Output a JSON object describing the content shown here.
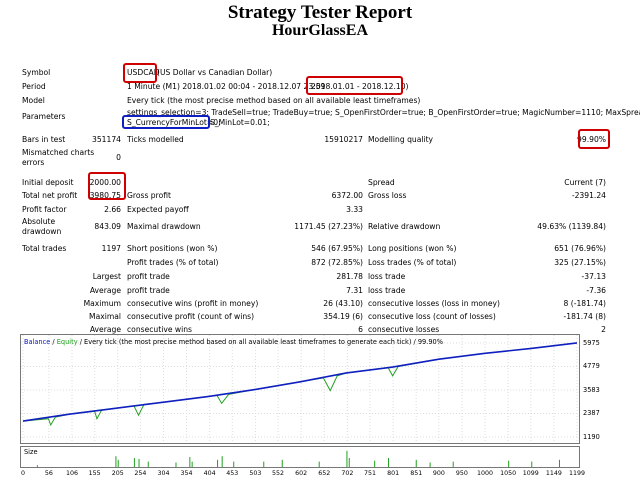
{
  "header": {
    "title": "Strategy Tester Report",
    "subtitle": "HourGlassEA"
  },
  "info": {
    "symbol_label": "Symbol",
    "symbol_code": "USDCAD",
    "symbol_desc": "(US Dollar vs Canadian Dollar)",
    "period_label": "Period",
    "period_prefix": "1 Minute (M1) 2018.01.02 00:04 - 2018.12.07 23:59",
    "period_range": "2018.01.01 - 2018.12.10)",
    "model_label": "Model",
    "model_value": "Every tick (the most precise method based on all available least timeframes)",
    "parameters_label": "Parameters",
    "param_line1": "settings_selection=3; TradeSell=true; TradeBuy=true; S_OpenFirstOrder=true; B_OpenFirstOrder=true; MagicNumber=1110; MaxSpread=5;",
    "param_highlight": "S_CurrencyForMinLot=0;",
    "param_rest": "S_MinLot=0.01;",
    "bars_label": "Bars in test",
    "bars_value": "351174",
    "ticks_label": "Ticks modelled",
    "ticks_value": "15910217",
    "quality_label": "Modelling quality",
    "quality_value": "99.90%",
    "mismatch_label_1": "Mismatched charts",
    "mismatch_label_2": "errors",
    "mismatch_value": "0"
  },
  "stats": {
    "initial_deposit_label": "Initial deposit",
    "initial_deposit_value": "2000.00",
    "spread_label": "Spread",
    "spread_value": "Current (7)",
    "net_profit_label": "Total net profit",
    "net_profit_value": "3980.75",
    "gross_profit_label": "Gross profit",
    "gross_profit_value": "6372.00",
    "gross_loss_label": "Gross loss",
    "gross_loss_value": "-2391.24",
    "profit_factor_label": "Profit factor",
    "profit_factor_value": "2.66",
    "expected_payoff_label": "Expected payoff",
    "expected_payoff_value": "3.33",
    "abs_dd_label_1": "Absolute",
    "abs_dd_label_2": "drawdown",
    "abs_dd_value": "843.09",
    "max_dd_label": "Maximal drawdown",
    "max_dd_value": "1171.45 (27.23%)",
    "rel_dd_label": "Relative drawdown",
    "rel_dd_value": "49.63% (1139.84)"
  },
  "trades": {
    "total_label": "Total trades",
    "total_value": "1197",
    "short_label": "Short positions (won %)",
    "short_value": "546 (67.95%)",
    "long_label": "Long positions (won %)",
    "long_value": "651 (76.96%)",
    "profit_trades_label": "Profit trades (% of total)",
    "profit_trades_value": "872 (72.85%)",
    "loss_trades_label": "Loss trades (% of total)",
    "loss_trades_value": "325 (27.15%)",
    "largest_label": "Largest",
    "largest_profit_label": "profit trade",
    "largest_profit_value": "281.78",
    "largest_loss_label": "loss trade",
    "largest_loss_value": "-37.13",
    "average_label": "Average",
    "average_profit_label": "profit trade",
    "average_profit_value": "7.31",
    "average_loss_label": "loss trade",
    "average_loss_value": "-7.36",
    "maximum_label": "Maximum",
    "max_wins_label": "consecutive wins (profit in money)",
    "max_wins_value": "26 (43.10)",
    "max_losses_label": "consecutive losses (loss in money)",
    "max_losses_value": "8 (-181.74)",
    "maximal_label": "Maximal",
    "maximal_profit_label": "consecutive profit (count of wins)",
    "maximal_profit_value": "354.19 (6)",
    "maximal_loss_label": "consecutive loss (count of losses)",
    "maximal_loss_value": "-181.74 (8)",
    "average2_label": "Average",
    "avg_wins_label": "consecutive wins",
    "avg_wins_value": "6",
    "avg_losses_label": "consecutive losses",
    "avg_losses_value": "2"
  },
  "chart_legend": {
    "balance": "Balance",
    "equity": "Equity",
    "rest": "/ Every tick (the most precise method based on all available least timeframes to generate each tick) / 99.90%",
    "sep": "/"
  },
  "size_label": "Size",
  "colors": {
    "balance": "#1020c0",
    "equity": "#20a020",
    "highlight_red": "#d00000",
    "highlight_blue": "#1020c0"
  },
  "chart_data": {
    "type": "line",
    "y_ticks": [
      "5975",
      "4779",
      "3583",
      "2387",
      "1190"
    ],
    "x_ticks": [
      "0",
      "56",
      "106",
      "155",
      "205",
      "254",
      "304",
      "354",
      "404",
      "453",
      "503",
      "552",
      "602",
      "652",
      "702",
      "751",
      "801",
      "851",
      "900",
      "950",
      "1000",
      "1050",
      "1099",
      "1149",
      "1199"
    ],
    "ylim": [
      1190,
      5975
    ],
    "xlim": [
      0,
      1199
    ],
    "series": [
      {
        "name": "Balance",
        "points": [
          [
            0,
            2000
          ],
          [
            100,
            2350
          ],
          [
            200,
            2650
          ],
          [
            300,
            2950
          ],
          [
            400,
            3250
          ],
          [
            500,
            3600
          ],
          [
            600,
            4000
          ],
          [
            700,
            4450
          ],
          [
            800,
            4750
          ],
          [
            900,
            5150
          ],
          [
            1000,
            5450
          ],
          [
            1100,
            5700
          ],
          [
            1199,
            5980
          ]
        ]
      },
      {
        "name": "Equity",
        "points": [
          [
            0,
            2000
          ],
          [
            55,
            2120
          ],
          [
            60,
            1800
          ],
          [
            70,
            2200
          ],
          [
            100,
            2350
          ],
          [
            155,
            2500
          ],
          [
            160,
            2120
          ],
          [
            170,
            2550
          ],
          [
            200,
            2650
          ],
          [
            240,
            2780
          ],
          [
            250,
            2300
          ],
          [
            262,
            2850
          ],
          [
            300,
            2950
          ],
          [
            400,
            3250
          ],
          [
            420,
            3300
          ],
          [
            430,
            2900
          ],
          [
            445,
            3360
          ],
          [
            500,
            3600
          ],
          [
            600,
            4000
          ],
          [
            650,
            4200
          ],
          [
            665,
            3550
          ],
          [
            680,
            4300
          ],
          [
            700,
            4450
          ],
          [
            790,
            4730
          ],
          [
            800,
            4300
          ],
          [
            812,
            4780
          ],
          [
            900,
            5150
          ],
          [
            1000,
            5450
          ],
          [
            1100,
            5700
          ],
          [
            1199,
            5980
          ]
        ]
      }
    ],
    "size_bars": [
      [
        30,
        0.1
      ],
      [
        200,
        0.6
      ],
      [
        205,
        0.4
      ],
      [
        240,
        0.5
      ],
      [
        250,
        0.45
      ],
      [
        270,
        0.3
      ],
      [
        330,
        0.25
      ],
      [
        360,
        0.55
      ],
      [
        365,
        0.3
      ],
      [
        420,
        0.4
      ],
      [
        430,
        0.6
      ],
      [
        455,
        0.3
      ],
      [
        520,
        0.3
      ],
      [
        560,
        0.4
      ],
      [
        640,
        0.3
      ],
      [
        700,
        0.9
      ],
      [
        705,
        0.5
      ],
      [
        760,
        0.35
      ],
      [
        790,
        0.5
      ],
      [
        850,
        0.4
      ],
      [
        880,
        0.25
      ],
      [
        930,
        0.3
      ],
      [
        1050,
        0.35
      ],
      [
        1100,
        0.3
      ],
      [
        1160,
        0.4
      ]
    ]
  }
}
